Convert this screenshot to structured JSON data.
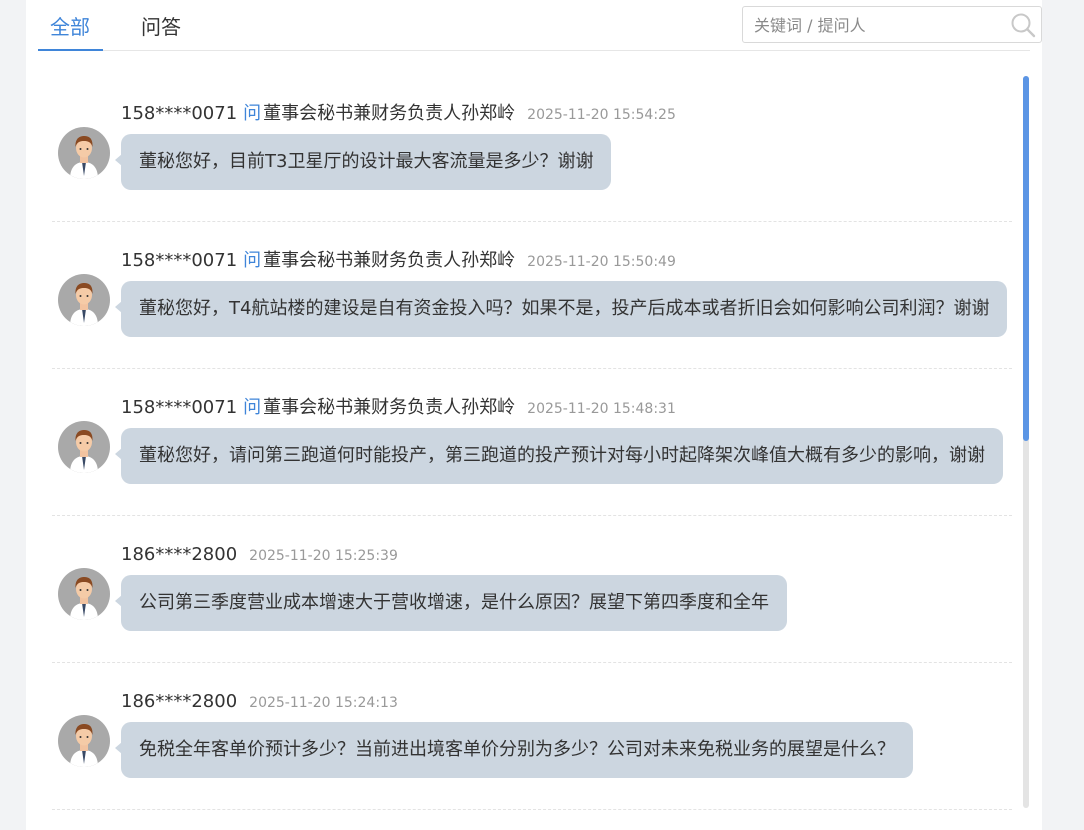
{
  "tabs": [
    {
      "label": "全部",
      "active": true
    },
    {
      "label": "问答",
      "active": false
    }
  ],
  "search": {
    "placeholder": "关键词 / 提问人",
    "value": ""
  },
  "ask_word": "问",
  "questions": [
    {
      "user": "158****0071",
      "target": "董事会秘书兼财务负责人孙郑岭",
      "time": "2025-11-20 15:54:25",
      "text": "董秘您好，目前T3卫星厅的设计最大客流量是多少？谢谢"
    },
    {
      "user": "158****0071",
      "target": "董事会秘书兼财务负责人孙郑岭",
      "time": "2025-11-20 15:50:49",
      "text": "董秘您好，T4航站楼的建设是自有资金投入吗？如果不是，投产后成本或者折旧会如何影响公司利润？谢谢"
    },
    {
      "user": "158****0071",
      "target": "董事会秘书兼财务负责人孙郑岭",
      "time": "2025-11-20 15:48:31",
      "text": "董秘您好，请问第三跑道何时能投产，第三跑道的投产预计对每小时起降架次峰值大概有多少的影响，谢谢"
    },
    {
      "user": "186****2800",
      "target": "",
      "time": "2025-11-20 15:25:39",
      "text": "公司第三季度营业成本增速大于营收增速，是什么原因？展望下第四季度和全年"
    },
    {
      "user": "186****2800",
      "target": "",
      "time": "2025-11-20 15:24:13",
      "text": "免税全年客单价预计多少？当前进出境客单价分别为多少？公司对未来免税业务的展望是什么？"
    }
  ],
  "colors": {
    "accent": "#3f85d9",
    "bubble": "#ccd6e0",
    "scroll_thumb": "#5b95e5"
  }
}
